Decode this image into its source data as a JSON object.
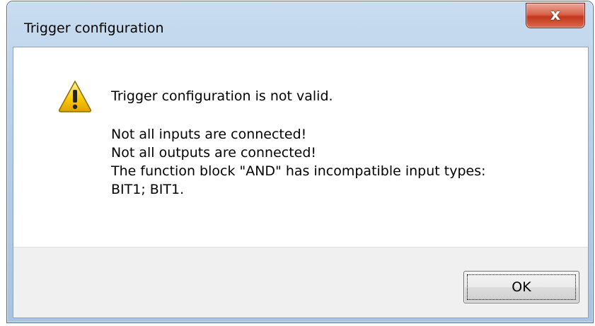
{
  "window": {
    "title": "Trigger configuration",
    "close_label": "x"
  },
  "message": {
    "heading": "Trigger configuration is not valid.",
    "lines": [
      "Not all inputs are connected!",
      "Not all outputs are connected!",
      "The function block \"AND\" has incompatible input types:",
      "BIT1; BIT1."
    ]
  },
  "buttons": {
    "ok_label": "OK"
  },
  "icons": {
    "warning": "warning-icon",
    "close": "close-icon"
  },
  "colors": {
    "close_button": "#c2381d",
    "title_bar": "#b7cfe8",
    "button_bar": "#f0f0f0",
    "warning_fill": "#f7c800"
  }
}
